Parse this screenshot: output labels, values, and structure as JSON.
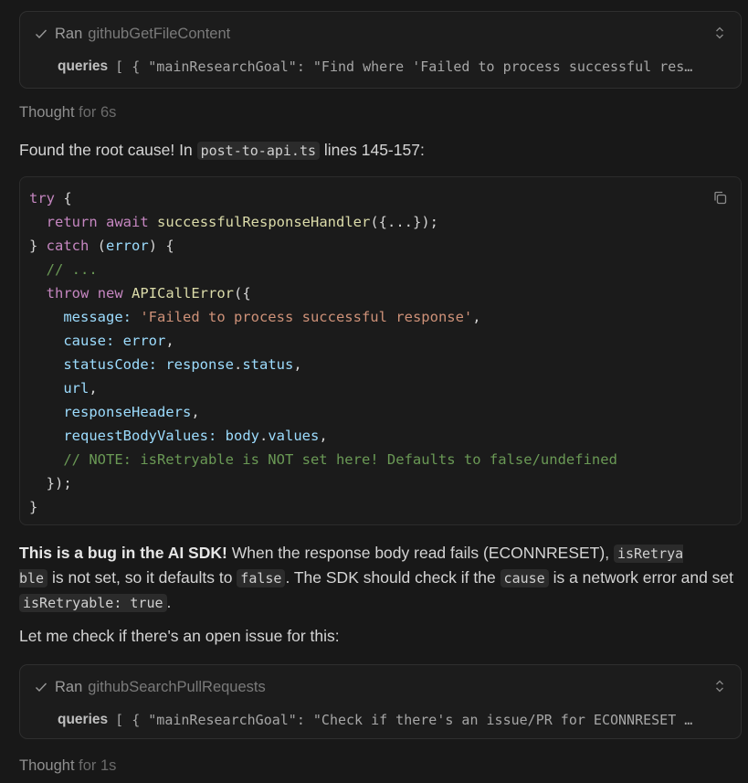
{
  "tool_calls": [
    {
      "ran": "Ran",
      "tool_name": "githubGetFileContent",
      "query_label": "queries",
      "query_value": "[ { \"mainResearchGoal\": \"Find where 'Failed to process successful res…"
    },
    {
      "ran": "Ran",
      "tool_name": "githubSearchPullRequests",
      "query_label": "queries",
      "query_value": "[ { \"mainResearchGoal\": \"Check if there's an issue/PR for ECONNRESET …"
    }
  ],
  "thoughts": [
    {
      "label": "Thought",
      "duration": "for 6s"
    },
    {
      "label": "Thought",
      "duration": "for 1s"
    }
  ],
  "intro": {
    "before": "Found the root cause! In ",
    "file": "post-to-api.ts",
    "after": " lines 145-157:"
  },
  "code": {
    "l1_kw": "try",
    "l1_rest": " {",
    "l2_kw1": "return",
    "l2_kw2": "await",
    "l2_fn": "successfulResponseHandler",
    "l2_rest": "({...});",
    "l3_a": "} ",
    "l3_kw": "catch",
    "l3_b": " (",
    "l3_var": "error",
    "l3_c": ") {",
    "l4_cm": "// ...",
    "l5_kw1": "throw",
    "l5_kw2": "new",
    "l5_fn": "APICallError",
    "l5_rest": "({",
    "l6_key": "message:",
    "l6_str": "'Failed to process successful response'",
    "l6_rest": ",",
    "l7_key": "cause:",
    "l7_val": "error",
    "l7_rest": ",",
    "l8_key": "statusCode:",
    "l8_obj": "response",
    "l8_dot": ".",
    "l8_prop": "status",
    "l8_rest": ",",
    "l9_key": "url",
    "l9_rest": ",",
    "l10_key": "responseHeaders",
    "l10_rest": ",",
    "l11_key": "requestBodyValues:",
    "l11_obj": "body",
    "l11_dot": ".",
    "l11_prop": "values",
    "l11_rest": ",",
    "l12_cm": "// NOTE: isRetryable is NOT set here! Defaults to false/undefined",
    "l13": "});",
    "l14": "}"
  },
  "explanation": {
    "bold": "This is a bug in the AI SDK!",
    "t1": " When the response body read fails (ECONNRESET), ",
    "c1a": "isRetrya",
    "c1b": "ble",
    "t2": " is not set, so it defaults to ",
    "c2": "false",
    "t3": ". The SDK should check if the ",
    "c3": "cause",
    "t4": " is a network error and set ",
    "c4": "isRetryable: true",
    "t5": "."
  },
  "check_issue": "Let me check if there's an open issue for this:",
  "icons": [
    "check-icon",
    "chevron-up-down-icon",
    "copy-icon"
  ]
}
